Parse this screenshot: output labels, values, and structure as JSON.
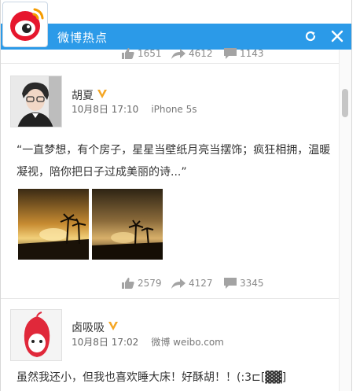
{
  "window": {
    "title": "微博热点"
  },
  "top_stats": {
    "likes": "1651",
    "reposts": "4612",
    "comments": "1143"
  },
  "posts": [
    {
      "username": "胡夏",
      "time": "10月8日 17:10",
      "source": "iPhone 5s",
      "text": "“一直梦想，有个房子，星星当壁纸月亮当摆饰；疯狂相拥，温暖凝视，陪你把日子过成美丽的诗...”",
      "stats": {
        "likes": "2579",
        "reposts": "4127",
        "comments": "3345"
      }
    },
    {
      "username": "卤吸吸",
      "time": "10月8日 17:02",
      "source": "微博 weibo.com",
      "text": "虽然我还小，但我也喜欢睡大床！好酥胡！！(:3⊏[▓▓]"
    }
  ],
  "colors": {
    "titlebar": "#2b9ae8",
    "verified_badge": "#f5a623",
    "icon_gray": "#9a9a9a"
  }
}
